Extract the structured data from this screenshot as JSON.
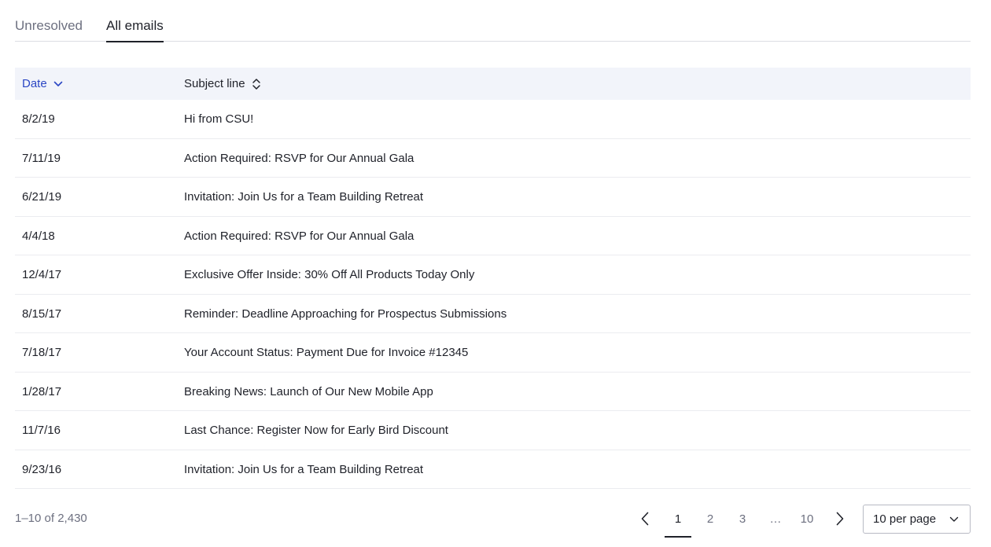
{
  "tabs": [
    {
      "label": "Unresolved",
      "active": false
    },
    {
      "label": "All emails",
      "active": true
    }
  ],
  "table": {
    "columns": {
      "date": {
        "label": "Date",
        "sort": "descending",
        "icon": "chevron-down-icon"
      },
      "subject": {
        "label": "Subject line",
        "sort": "none",
        "icon": "sort-icon"
      }
    },
    "rows": [
      {
        "date": "8/2/19",
        "subject": "Hi from CSU!"
      },
      {
        "date": "7/11/19",
        "subject": "Action Required: RSVP for Our Annual Gala"
      },
      {
        "date": "6/21/19",
        "subject": "Invitation: Join Us for a Team Building Retreat"
      },
      {
        "date": "4/4/18",
        "subject": "Action Required: RSVP for Our Annual Gala"
      },
      {
        "date": "12/4/17",
        "subject": "Exclusive Offer Inside: 30% Off All Products Today Only"
      },
      {
        "date": "8/15/17",
        "subject": "Reminder: Deadline Approaching for Prospectus Submissions"
      },
      {
        "date": "7/18/17",
        "subject": "Your Account Status: Payment Due for Invoice #12345"
      },
      {
        "date": "1/28/17",
        "subject": "Breaking News: Launch of Our New Mobile App"
      },
      {
        "date": "11/7/16",
        "subject": "Last Chance: Register Now for Early Bird Discount"
      },
      {
        "date": "9/23/16",
        "subject": "Invitation: Join Us for a Team Building Retreat"
      }
    ]
  },
  "pagination": {
    "range_text": "1–10 of 2,430",
    "pages": [
      "1",
      "2",
      "3"
    ],
    "ellipsis": "…",
    "last_page": "10",
    "current_page": "1",
    "per_page_label": "10 per page"
  },
  "colors": {
    "accent": "#2b46c4",
    "header_bg": "#f2f4fa",
    "text": "#1f2129",
    "muted": "#6d7080",
    "border": "#ebecf0"
  }
}
